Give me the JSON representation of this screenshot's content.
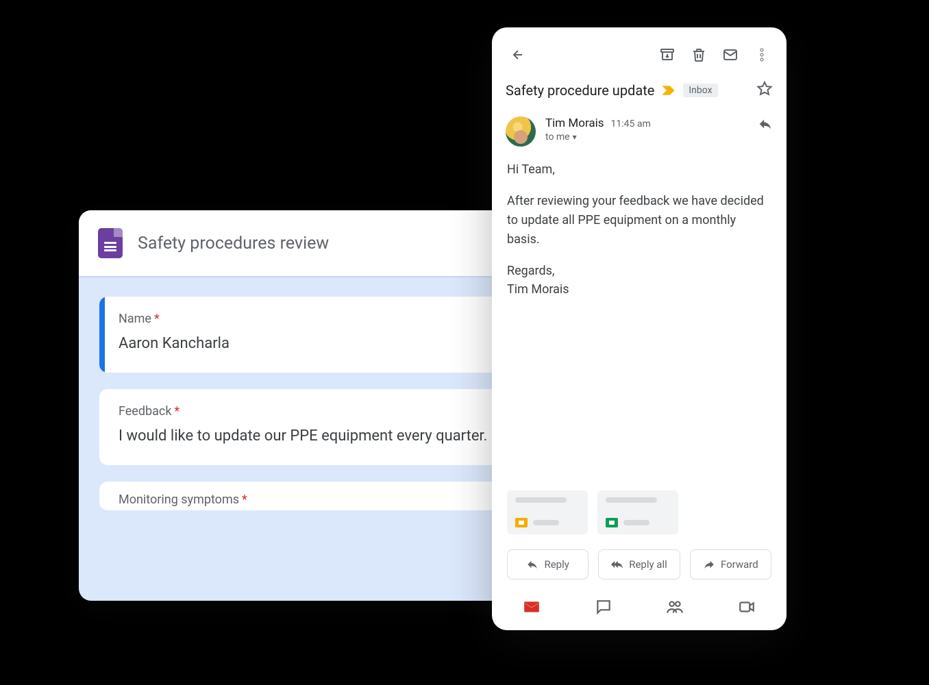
{
  "forms": {
    "title": "Safety procedures review",
    "fields": {
      "name": {
        "label": "Name",
        "required": "*",
        "value": "Aaron Kancharla"
      },
      "feedback": {
        "label": "Feedback",
        "required": "*",
        "value": "I would like to update our PPE equipment every quarter."
      },
      "third": {
        "label": "Monitoring symptoms",
        "required": "*"
      }
    }
  },
  "gmail": {
    "subject": "Safety procedure update",
    "inbox_chip": "Inbox",
    "sender": {
      "name": "Tim Morais",
      "time": "11:45 am",
      "to": "to me"
    },
    "body": {
      "greeting": "Hi Team,",
      "paragraph": "After reviewing your feedback we have decided to update all PPE equipment on a monthly basis.",
      "signoff": "Regards,\nTim Morais"
    },
    "actions": {
      "reply": "Reply",
      "reply_all": "Reply all",
      "forward": "Forward"
    }
  }
}
